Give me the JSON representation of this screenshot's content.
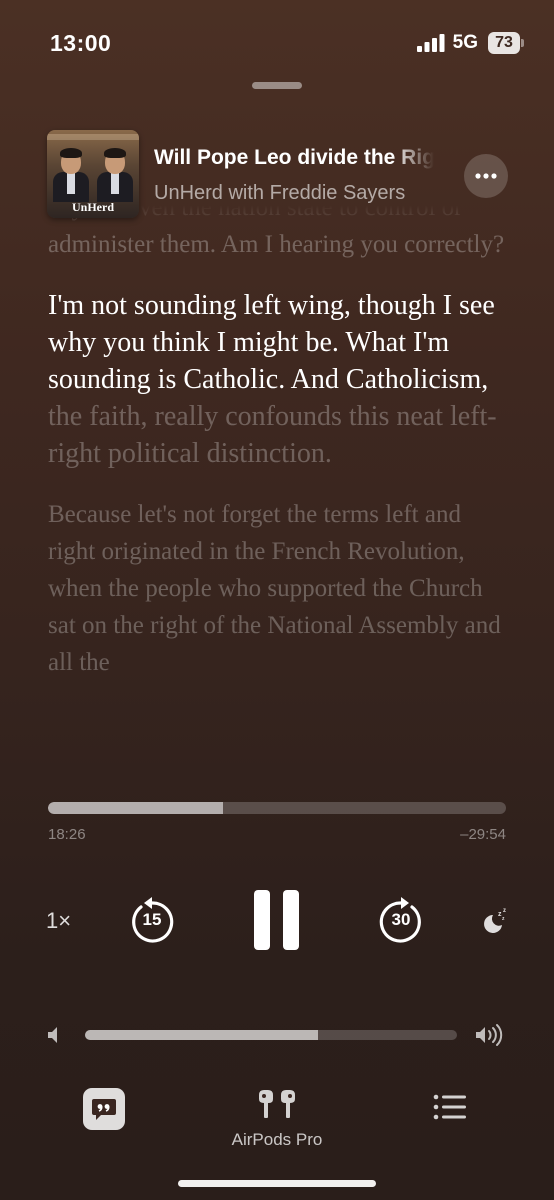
{
  "status_bar": {
    "time": "13:00",
    "network": "5G",
    "battery": "73"
  },
  "episode": {
    "title": "Will Pope Leo divide the Right?",
    "show": "UnHerd with Freddie Sayers",
    "artwork_logo": "UnHerd"
  },
  "transcript": {
    "previous": "beyond even the nation state to control or administer them. Am I hearing you correctly?",
    "current_spoken": "I'm not sounding left wing, though I see why you think I might be. What I'm sounding is Catholic. And Catholicism,",
    "current_upcoming": " the faith, really confounds this neat left-right political distinction.",
    "next": "Because let's not forget the terms left and right originated in the French Revolution, when the people who supported the Church sat on the right of the National Assembly and all the"
  },
  "playback": {
    "elapsed": "18:26",
    "remaining": "–29:54",
    "progress_fraction": 0.383,
    "speed": "1×",
    "skip_back": "15",
    "skip_forward": "30",
    "state": "playing"
  },
  "volume": {
    "level_fraction": 0.625
  },
  "bottom_bar": {
    "output_device": "AirPods Pro"
  },
  "icons": {
    "signal": "cellular-signal-icon",
    "battery": "battery-icon",
    "more": "ellipsis-icon",
    "pause": "pause-icon",
    "skip_back": "gobackward-15-icon",
    "skip_forward": "goforward-30-icon",
    "sleep": "sleep-timer-moon-icon",
    "volume_low": "speaker-low-icon",
    "volume_high": "speaker-high-icon",
    "transcript": "quote-bubble-icon",
    "airpods": "airpods-pro-icon",
    "queue": "list-queue-icon"
  }
}
